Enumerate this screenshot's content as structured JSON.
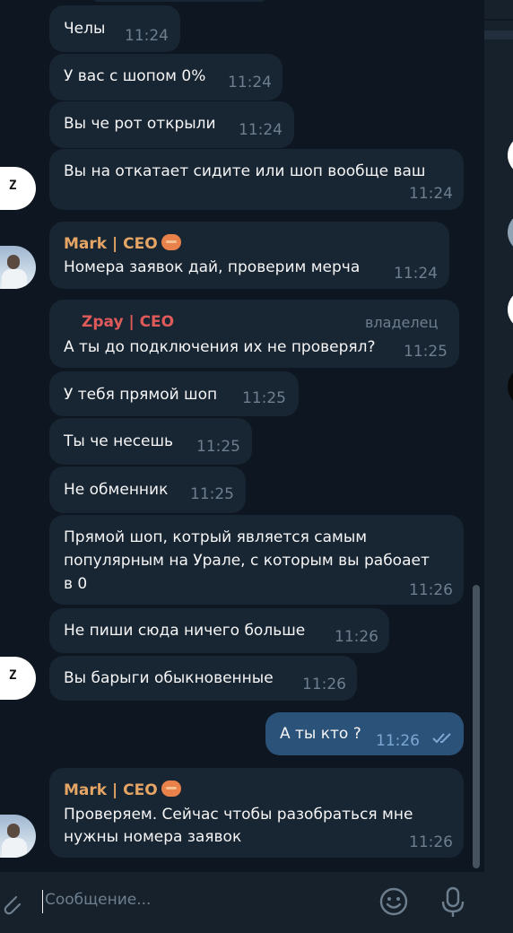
{
  "messages": [
    {
      "kind": "text",
      "text": "Челы",
      "time": "11:24"
    },
    {
      "kind": "text",
      "text": "У вас с шопом 0%",
      "time": "11:24"
    },
    {
      "kind": "text",
      "text": "Вы че рот открыли",
      "time": "11:24"
    },
    {
      "kind": "text",
      "text": "Вы на откатает сидите или шоп вообще ваш",
      "time": "11:24",
      "avatar": "z-logo"
    },
    {
      "kind": "named",
      "sender": "Mark | CEO",
      "text": "Номера заявок дай, проверим мерча",
      "time": "11:24",
      "avatar": "photo"
    },
    {
      "kind": "named",
      "sender": "Zpay | CEO",
      "role": "владелец",
      "text": "А ты до подключения их не проверял?",
      "time": "11:25"
    },
    {
      "kind": "text",
      "text": "У тебя прямой шоп",
      "time": "11:25"
    },
    {
      "kind": "text",
      "text": "Ты че несешь",
      "time": "11:25"
    },
    {
      "kind": "text",
      "text": "Не обменник",
      "time": "11:25"
    },
    {
      "kind": "multiline",
      "lines": [
        "Прямой шоп, котрый является самым",
        "популярным на Урале, с которым вы рабоает",
        "в 0"
      ],
      "time": "11:26"
    },
    {
      "kind": "text",
      "text": "Не пиши сюда ничего больше",
      "time": "11:26"
    },
    {
      "kind": "text",
      "text": "Вы барыги обыкновенные",
      "time": "11:26",
      "avatar": "z-logo"
    },
    {
      "kind": "outgoing",
      "text": "А ты кто ?",
      "time": "11:26",
      "status": "read-double-check"
    },
    {
      "kind": "named",
      "sender": "Mark | CEO",
      "lines": [
        "Проверяем. Сейчас чтобы разобраться мне",
        "нужны номера заявок"
      ],
      "time": "11:26",
      "avatar": "photo"
    }
  ],
  "colors": {
    "mark_name": "#e5a564",
    "zpay_name": "#e05a5a",
    "incoming_bubble": "#182533",
    "outgoing_bubble": "#2b5278",
    "background": "#0e1621"
  },
  "input": {
    "placeholder": "Сообщение..."
  },
  "icons": {
    "attach": "paperclip-icon",
    "emoji": "emoji-icon",
    "mic": "microphone-icon",
    "read": "double-check-icon",
    "badge": "ceo-badge-icon"
  },
  "avatar_letter": "Z"
}
